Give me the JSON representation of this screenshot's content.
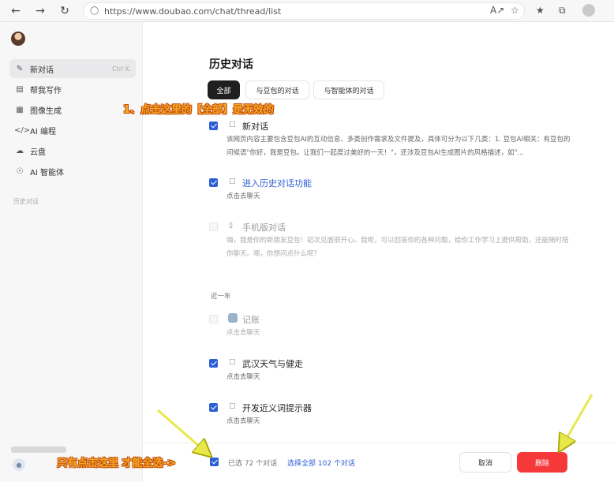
{
  "browser": {
    "url": "https://www.doubao.com/chat/thread/list",
    "icons": [
      "back-icon",
      "forward-icon",
      "refresh-icon",
      "lock-icon",
      "read-aloud-icon",
      "favorite-add-icon",
      "favorites-icon",
      "collections-icon",
      "profile-icon"
    ]
  },
  "sidebar": {
    "items": [
      {
        "label": "新对话",
        "icon": "edit-icon",
        "shortcut": "Ctrl K"
      },
      {
        "label": "帮我写作",
        "icon": "write-icon"
      },
      {
        "label": "图像生成",
        "icon": "image-icon"
      },
      {
        "label": "AI 编程",
        "icon": "code-icon"
      },
      {
        "label": "云盘",
        "icon": "cloud-icon"
      },
      {
        "label": "AI 智能体",
        "icon": "agent-icon"
      }
    ],
    "section_label": "历史对话"
  },
  "main": {
    "title": "历史对话",
    "tabs": [
      {
        "label": "全部"
      },
      {
        "label": "与豆包的对话"
      },
      {
        "label": "与智能体的对话"
      }
    ],
    "items": [
      {
        "title": "新对话",
        "desc": "该网页内容主要包含豆包AI的互动信息、多类创作需求及文件提及，具体可分为以下几类：1. 豆包AI相关：有豆包的问候语\"你好，我是豆包。让我们一起度过美好的一天！\"，还涉及豆包AI生成图片的风格描述，如\"..."
      },
      {
        "title": "进入历史对话功能",
        "desc": "点击去聊天"
      },
      {
        "title": "手机版对话",
        "desc": "嗨，我是你的新朋友豆包！初次见面很开心。我呢，可以回答你的各种问题，给你工作学习上提供帮助，还能随时陪你聊天。嗯，你想问点什么呢？"
      }
    ],
    "section_year": "近一年",
    "year_items": [
      {
        "title": "记账",
        "desc": "点击去聊天"
      },
      {
        "title": "武汉天气与健走",
        "desc": "点击去聊天"
      },
      {
        "title": "开发近义词提示器",
        "desc": "点击去聊天"
      }
    ]
  },
  "footer": {
    "selected": "已选 72 个对话",
    "select_all": "选择全部 102 个对话",
    "cancel": "取消",
    "delete": "删除"
  },
  "annotations": {
    "top": "1、点击这里的【全部】是无效的",
    "bottom": "只有点击这里 才能全选->"
  },
  "colors": {
    "accent": "#2c5ed6",
    "delete": "#f5393b",
    "annotation_fill": "#f4a92b",
    "annotation_stroke": "#c34a00",
    "arrow": "#e8e84a"
  }
}
